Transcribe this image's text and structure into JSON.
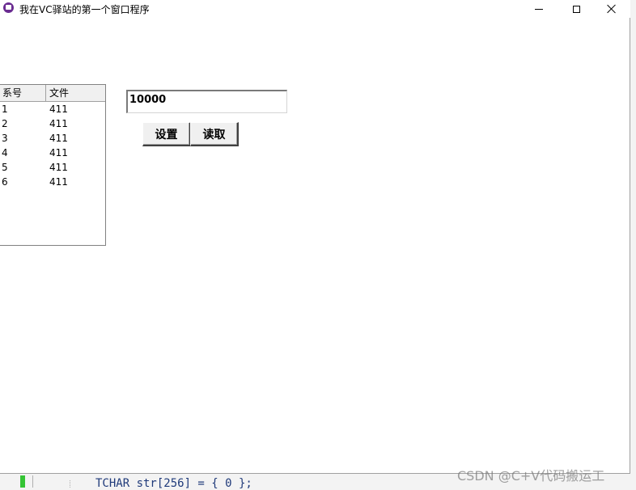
{
  "window": {
    "title": "我在VC驿站的第一个窗口程序"
  },
  "listview": {
    "columns": [
      "系号",
      "文件"
    ],
    "rows": [
      [
        "1",
        "411"
      ],
      [
        "2",
        "411"
      ],
      [
        "3",
        "411"
      ],
      [
        "4",
        "411"
      ],
      [
        "5",
        "411"
      ],
      [
        "6",
        "411"
      ]
    ]
  },
  "edit": {
    "value": "10000"
  },
  "buttons": {
    "set_label": "设置",
    "read_label": "读取"
  },
  "background": {
    "code_line": "TCHAR str[256] = { 0 };",
    "watermark": "CSDN @C+V代码搬运工"
  },
  "colors": {
    "app_icon": "#6a2c91",
    "editor_marker": "#35c435"
  },
  "icons": {
    "app": "app-icon",
    "minimize": "minimize-icon",
    "maximize": "maximize-icon",
    "close": "close-icon"
  }
}
